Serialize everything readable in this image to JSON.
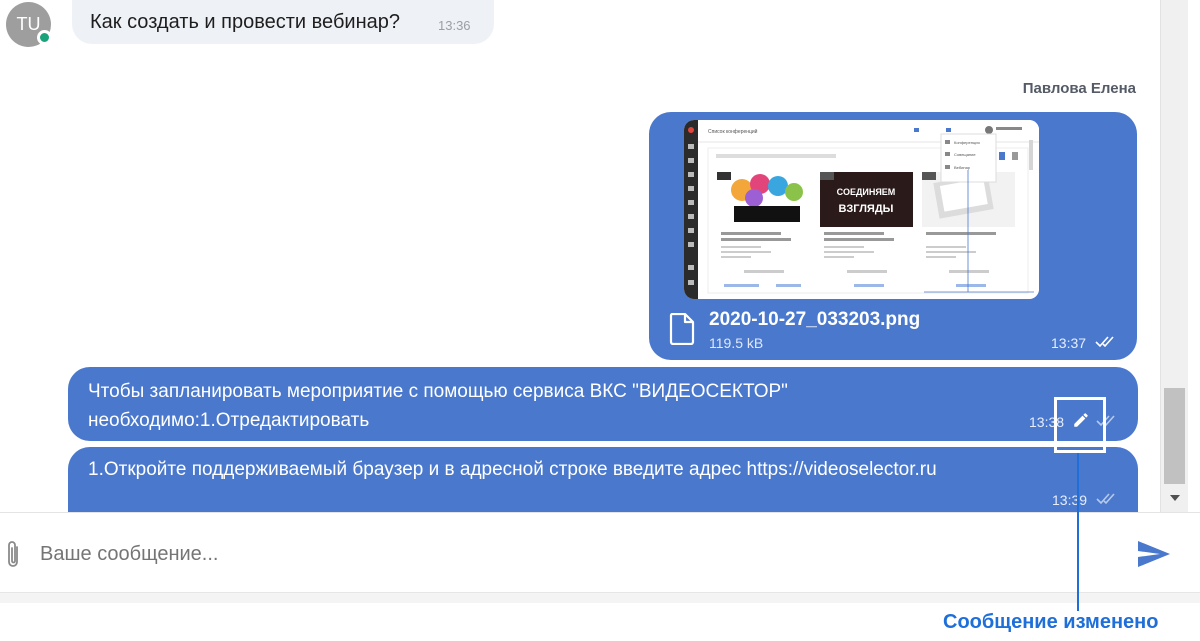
{
  "incoming": {
    "avatar_initials": "TU",
    "text": "Как создать и провести вебинар?",
    "time": "13:36"
  },
  "outgoing_sender": "Павлова Елена",
  "attachment": {
    "file_name": "2020-10-27_033203.png",
    "file_size": "119.5 kB",
    "time": "13:37",
    "thumbnail": {
      "page_title": "Список конференций",
      "cards": [
        {
          "image_text": "",
          "title": "Демонстрация функциональных возможностей сервиса..."
        },
        {
          "image_text": "СОЕДИНЯЕМ ВЗГЛЯДЫ",
          "title": "Демонстрация функциональных возможностей сервиса..."
        },
        {
          "image_text": "",
          "title": "Как создать и провести вебинар?"
        }
      ],
      "menu_items": [
        "Конференция",
        "Совещание",
        "Вебинар"
      ]
    }
  },
  "messages": [
    {
      "text": "Чтобы запланировать мероприятие с помощью сервиса ВКС \"ВИДЕОСЕКТОР\" необходимо:1.Отредактировать",
      "time": "13:38"
    },
    {
      "text": "1.Откройте поддерживаемый браузер и в адресной строке введите адрес https://videoselector.ru",
      "time": "13:39"
    }
  ],
  "composer": {
    "placeholder": "Ваше сообщение..."
  },
  "annotation": {
    "label": "Сообщение изменено"
  },
  "colors": {
    "bubble": "#4a78cc",
    "incoming_bubble": "#eef1f6",
    "online": "#1aa37a",
    "annotation": "#1e6fd9"
  }
}
